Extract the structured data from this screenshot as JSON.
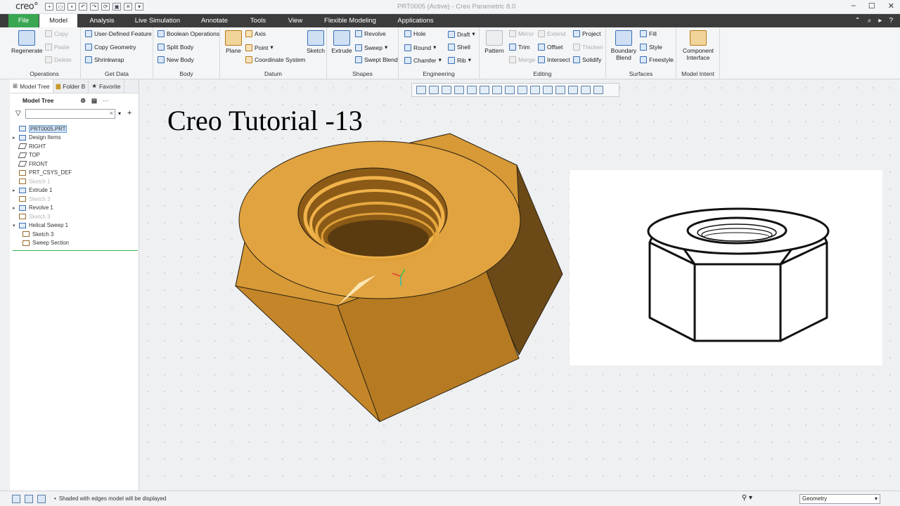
{
  "window": {
    "logo": "creo°",
    "title": "PRT0005 (Active) - Creo Parametric 8.0"
  },
  "tabs": {
    "file": "File",
    "model": "Model",
    "analysis": "Analysis",
    "live_simulation": "Live Simulation",
    "annotate": "Annotate",
    "tools": "Tools",
    "view": "View",
    "flexible_modeling": "Flexible Modeling",
    "applications": "Applications"
  },
  "ribbon": {
    "operations": {
      "label": "Operations",
      "regenerate": "Regenerate",
      "copy": "Copy",
      "paste": "Paste",
      "delete": "Delete"
    },
    "get_data": {
      "label": "Get Data",
      "udf": "User-Defined Feature",
      "copy_geometry": "Copy Geometry",
      "shrinkwrap": "Shrinkwrap"
    },
    "body": {
      "label": "Body",
      "boolean": "Boolean Operations",
      "split": "Split Body",
      "new": "New Body"
    },
    "datum": {
      "label": "Datum",
      "plane": "Plane",
      "axis": "Axis",
      "point": "Point",
      "csys": "Coordinate System",
      "sketch": "Sketch"
    },
    "shapes": {
      "label": "Shapes",
      "extrude": "Extrude",
      "revolve": "Revolve",
      "sweep": "Sweep",
      "swept_blend": "Swept Blend"
    },
    "engineering": {
      "label": "Engineering",
      "hole": "Hole",
      "round": "Round",
      "chamfer": "Chamfer",
      "draft": "Draft",
      "shell": "Shell",
      "rib": "Rib"
    },
    "editing": {
      "label": "Editing",
      "pattern": "Pattern",
      "mirror": "Mirror",
      "trim": "Trim",
      "merge": "Merge",
      "extend": "Extend",
      "offset": "Offset",
      "intersect": "Intersect",
      "project": "Project",
      "thicken": "Thicken",
      "solidify": "Solidify"
    },
    "surfaces": {
      "label": "Surfaces",
      "boundary_blend": "Boundary Blend",
      "fill": "Fill",
      "style": "Style",
      "freestyle": "Freestyle"
    },
    "model_intent": {
      "label": "Model Intent",
      "component_interface": "Component Interface"
    }
  },
  "panel": {
    "tabs": [
      "Model Tree",
      "Folder B",
      "Favorite"
    ],
    "header": "Model Tree",
    "tree": [
      {
        "label": "PRT0005.PRT",
        "state": "selected"
      },
      {
        "label": "Design Items",
        "state": "normal"
      },
      {
        "label": "RIGHT",
        "state": "normal"
      },
      {
        "label": "TOP",
        "state": "normal"
      },
      {
        "label": "FRONT",
        "state": "normal"
      },
      {
        "label": "PRT_CSYS_DEF",
        "state": "normal"
      },
      {
        "label": "Sketch 1",
        "state": "suppressed"
      },
      {
        "label": "Extrude 1",
        "state": "normal"
      },
      {
        "label": "Sketch 3",
        "state": "suppressed"
      },
      {
        "label": "Revolve 1",
        "state": "normal"
      },
      {
        "label": "Sketch 3",
        "state": "suppressed"
      },
      {
        "label": "Helical Sweep 1",
        "state": "normal"
      },
      {
        "label": "Sketch 3",
        "state": "normal"
      },
      {
        "label": "Sweep Section",
        "state": "normal"
      }
    ]
  },
  "canvas": {
    "tutorial_title": "Creo Tutorial -13"
  },
  "status": {
    "message": "Shaded with edges model will be displayed",
    "filter": "Geometry"
  },
  "colors": {
    "file_tab": "#3aa652",
    "nut_top": "#e0a33f",
    "nut_face": "#b77a22",
    "nut_dark": "#6b4a17"
  }
}
